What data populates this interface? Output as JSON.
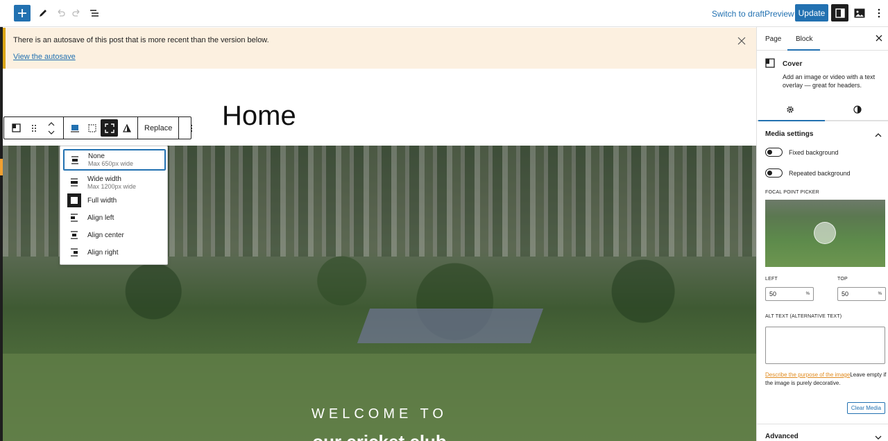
{
  "topbar": {
    "switch_draft": "Switch to draft",
    "preview": "Preview",
    "update": "Update"
  },
  "notice": {
    "message": "There is an autosave of this post that is more recent than the version below.",
    "link": "View the autosave"
  },
  "canvas": {
    "page_title": "Home",
    "cover_heading": "WELCOME TO",
    "cover_subheading": "our cricket club"
  },
  "block_toolbar": {
    "replace": "Replace"
  },
  "align_menu": {
    "items": [
      {
        "label": "None",
        "hint": "Max 650px wide"
      },
      {
        "label": "Wide width",
        "hint": "Max 1200px wide"
      },
      {
        "label": "Full width"
      },
      {
        "label": "Align left"
      },
      {
        "label": "Align center"
      },
      {
        "label": "Align right"
      }
    ]
  },
  "sidebar": {
    "tabs": [
      "Page",
      "Block"
    ],
    "block_name": "Cover",
    "block_desc": "Add an image or video with a text overlay — great for headers.",
    "panel_title": "Media settings",
    "fixed_bg": "Fixed background",
    "repeated_bg": "Repeated background",
    "focal_label": "FOCAL POINT PICKER",
    "left_label": "LEFT",
    "top_label": "TOP",
    "left_value": "50",
    "top_value": "50",
    "unit": "%",
    "alt_label": "ALT TEXT (ALTERNATIVE TEXT)",
    "alt_help_link": "Describe the purpose of the image",
    "alt_help_text": "Leave empty if the image is purely decorative.",
    "clear_media": "Clear Media",
    "advanced": "Advanced"
  },
  "colors": {
    "accent": "#2271b1",
    "notice_bg": "#fcf0e0",
    "notice_border": "#dba617"
  }
}
